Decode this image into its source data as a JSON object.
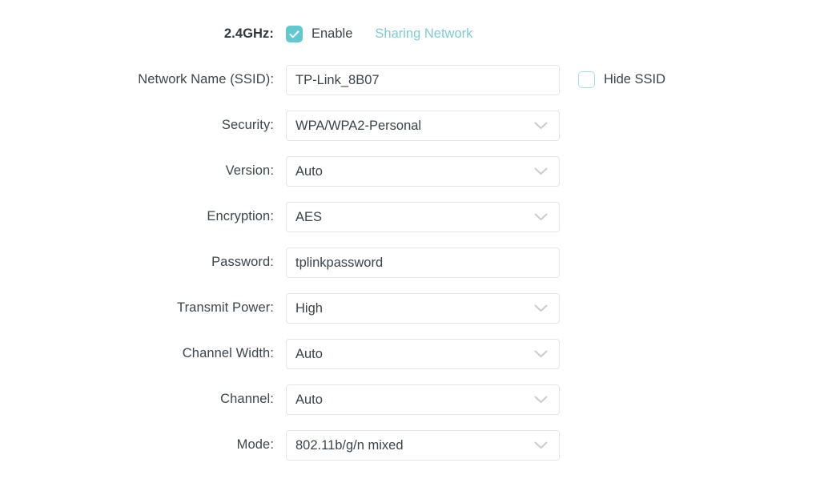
{
  "band": {
    "label": "2.4GHz:",
    "enable_label": "Enable",
    "enable_checked": true,
    "sharing_network_link": "Sharing Network"
  },
  "ssid": {
    "label": "Network Name (SSID):",
    "value": "TP-Link_8B07",
    "placeholder": "",
    "hide_ssid_label": "Hide SSID",
    "hide_ssid_checked": false
  },
  "fields": [
    {
      "label": "Security:",
      "value": "WPA/WPA2-Personal",
      "type": "select"
    },
    {
      "label": "Version:",
      "value": "Auto",
      "type": "select"
    },
    {
      "label": "Encryption:",
      "value": "AES",
      "type": "select"
    },
    {
      "label": "Password:",
      "value": "tplinkpassword",
      "type": "text"
    },
    {
      "label": "Transmit Power:",
      "value": "High",
      "type": "select"
    },
    {
      "label": "Channel Width:",
      "value": "Auto",
      "type": "select"
    },
    {
      "label": "Channel:",
      "value": "Auto",
      "type": "select"
    },
    {
      "label": "Mode:",
      "value": "802.11b/g/n mixed",
      "type": "select"
    }
  ],
  "colors": {
    "accent_teal": "#5fc9cf",
    "link_teal": "#7ccdd4",
    "checkbox_border": "#a7dfe4",
    "field_border": "#e2e4e6",
    "text": "#3a444a",
    "chevron": "#c9cccf",
    "background": "#ffffff"
  },
  "icons": {
    "check": "check-icon",
    "chevron_down": "chevron-down-icon"
  }
}
